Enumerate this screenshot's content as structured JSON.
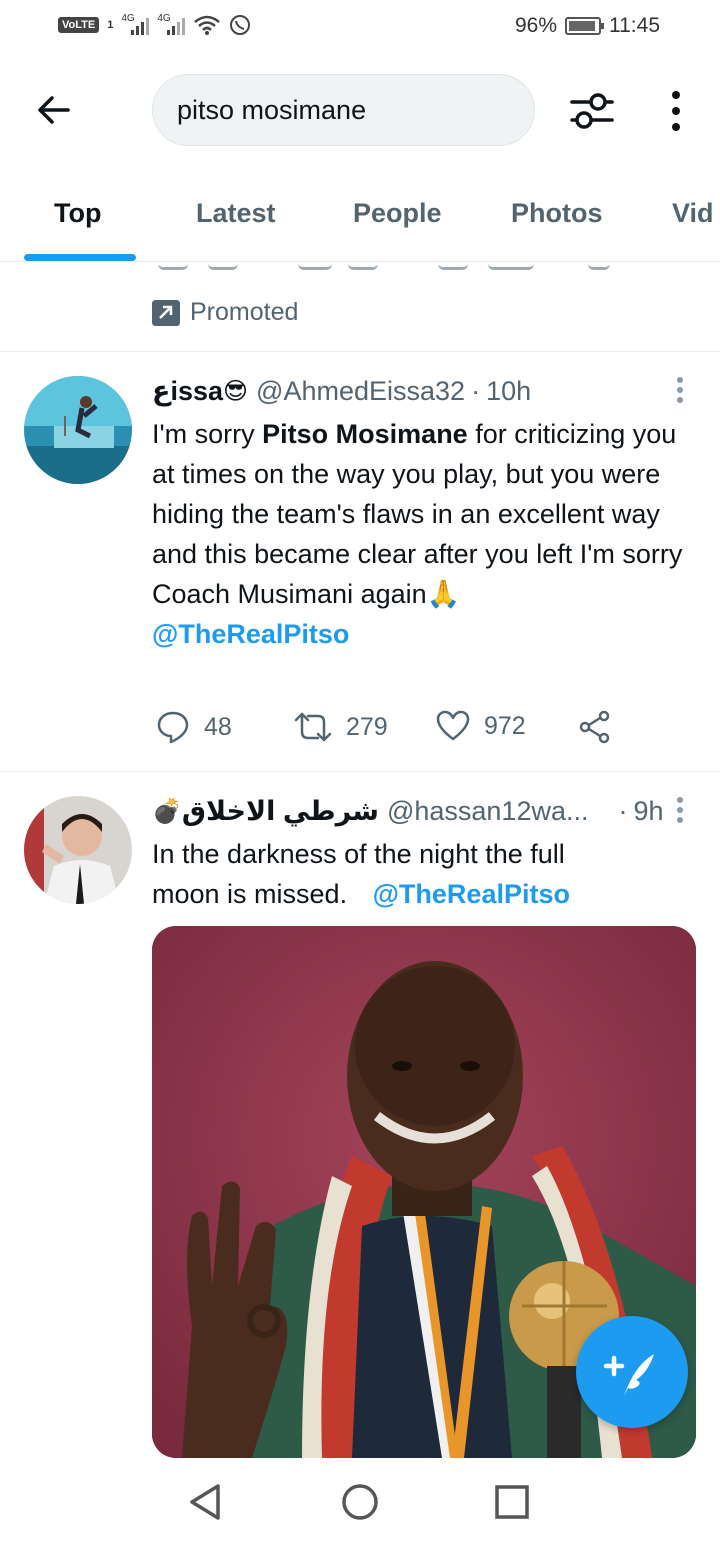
{
  "status_bar": {
    "volte": "VoLTE",
    "sim": "1",
    "network_1": "4G",
    "network_2": "4G",
    "battery": "96%",
    "time": "11:45"
  },
  "search": {
    "query": "pitso mosimane"
  },
  "tabs": [
    {
      "label": "Top",
      "active": true
    },
    {
      "label": "Latest",
      "active": false
    },
    {
      "label": "People",
      "active": false
    },
    {
      "label": "Photos",
      "active": false
    },
    {
      "label": "Vid",
      "active": false
    }
  ],
  "promoted": {
    "label": "Promoted"
  },
  "tweets": [
    {
      "name": "عissa",
      "name_emoji": "😎",
      "handle": "@AhmedEissa32",
      "sep": "·",
      "time": "10h",
      "text_1": "I'm sorry ",
      "text_bold": "Pitso Mosimane",
      "text_2": " for criticizing you at times on the way you play, but you were hiding the team's flaws in an excellent way and this became clear after you left I'm sorry Coach Musimani again",
      "text_emoji": "🙏",
      "mention": "@TheRealPitso",
      "replies": "48",
      "retweets": "279",
      "likes": "972"
    },
    {
      "name": "شرطي الاخلاق",
      "name_emoji": "💣",
      "handle": "@hassan12wa...",
      "sep": "·",
      "time": "9h",
      "text": "In the darkness of the night the full moon is missed.",
      "mention": "@TheRealPitso"
    }
  ],
  "colors": {
    "accent": "#1d9bf0",
    "text_primary": "#0f1419",
    "text_secondary": "#536471",
    "divider": "#e6ecf0"
  }
}
